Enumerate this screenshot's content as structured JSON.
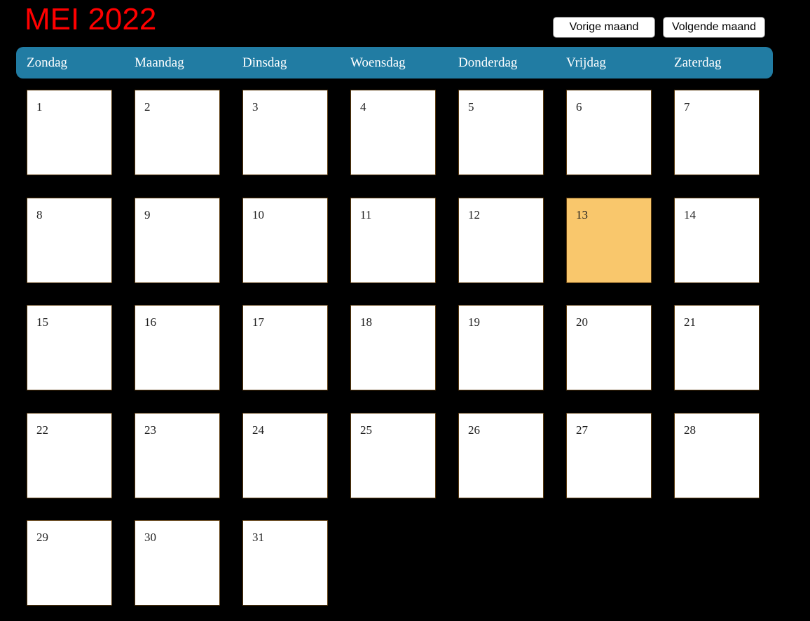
{
  "calendar": {
    "title": "MEI 2022",
    "prev_label": "Vorige maand",
    "next_label": "Volgende maand",
    "weekdays": [
      "Zondag",
      "Maandag",
      "Dinsdag",
      "Woensdag",
      "Donderdag",
      "Vrijdag",
      "Zaterdag"
    ],
    "first_weekday_index": 0,
    "day_count": 31,
    "highlighted_day": 13
  },
  "colors": {
    "title": "#ff0000",
    "header_bar": "#217ca3",
    "highlight": "#f9c76c",
    "page_background": "#000000"
  }
}
